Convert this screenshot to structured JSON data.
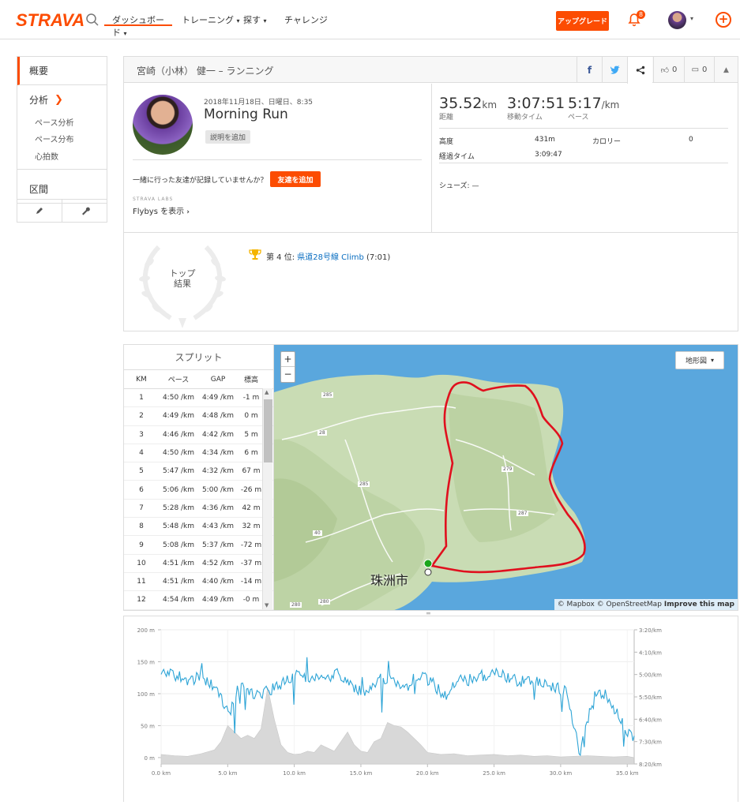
{
  "nav": {
    "logo": "STRAVA",
    "items": [
      "ダッシュボード",
      "トレーニング",
      "探す",
      "チャレンジ"
    ],
    "upgrade": "アップグレード",
    "notifications": "8"
  },
  "sidebar": {
    "overview": "概要",
    "analysis": "分析",
    "sub": [
      "ペース分析",
      "ペース分布",
      "心拍数"
    ],
    "segments": "区間"
  },
  "activity": {
    "header": "宮崎（小林） 健一 – ランニング",
    "kudos": "0",
    "comments": "0",
    "date": "2018年11月18日、日曜日、8:35",
    "title": "Morning Run",
    "add_desc": "説明を追加",
    "friends_question": "一緒に行った友達が記録していませんか？",
    "add_friends": "友達を追加",
    "labs": "STRAVA LABS",
    "flybys": "Flybys を表示",
    "stats": {
      "distance": "35.52",
      "distance_unit": "km",
      "distance_label": "距離",
      "moving_time": "3:07:51",
      "moving_label": "移動タイム",
      "pace": "5:17",
      "pace_unit": "/km",
      "pace_label": "ペース"
    },
    "elevation_label": "高度",
    "elevation_value": "431m",
    "calories_label": "カロリー",
    "calories_value": "0",
    "elapsed_label": "経過タイム",
    "elapsed_value": "3:09:47",
    "shoes": "シューズ: —",
    "top_results": "トップ\n結果",
    "achievement_prefix": "第 4 位: ",
    "achievement_link": "県道28号線 Climb",
    "achievement_time": " (7:01)"
  },
  "splits": {
    "title": "スプリット",
    "headers": [
      "KM",
      "ペース",
      "GAP",
      "標高"
    ],
    "rows": [
      [
        "1",
        "4:50 /km",
        "4:49 /km",
        "-1 m"
      ],
      [
        "2",
        "4:49 /km",
        "4:48 /km",
        "0 m"
      ],
      [
        "3",
        "4:46 /km",
        "4:42 /km",
        "5 m"
      ],
      [
        "4",
        "4:50 /km",
        "4:34 /km",
        "6 m"
      ],
      [
        "5",
        "5:47 /km",
        "4:32 /km",
        "67 m"
      ],
      [
        "6",
        "5:06 /km",
        "5:00 /km",
        "-26 m"
      ],
      [
        "7",
        "5:28 /km",
        "4:36 /km",
        "42 m"
      ],
      [
        "8",
        "5:48 /km",
        "4:43 /km",
        "32 m"
      ],
      [
        "9",
        "5:08 /km",
        "5:37 /km",
        "-72 m"
      ],
      [
        "10",
        "4:51 /km",
        "4:52 /km",
        "-37 m"
      ],
      [
        "11",
        "4:51 /km",
        "4:40 /km",
        "-14 m"
      ],
      [
        "12",
        "4:54 /km",
        "4:49 /km",
        "-0 m"
      ]
    ]
  },
  "map": {
    "terrain": "地形図",
    "city": "珠洲市",
    "attribution": "© Mapbox © OpenStreetMap",
    "improve": "Improve this map",
    "road_labels": [
      "285",
      "28",
      "285",
      "40",
      "280",
      "280",
      "279",
      "287",
      "28",
      "28",
      "28",
      "28"
    ]
  },
  "chart_data": {
    "type": "line",
    "x_ticks": [
      "0.0 km",
      "5.0 km",
      "10.0 km",
      "15.0 km",
      "20.0 km",
      "25.0 km",
      "30.0 km",
      "35.0 km"
    ],
    "y_left_ticks": [
      "200 m",
      "150 m",
      "100 m",
      "50 m",
      "0 m"
    ],
    "y_right_ticks": [
      "3:20/km",
      "4:10/km",
      "5:00/km",
      "5:50/km",
      "6:40/km",
      "7:30/km",
      "8:20/km"
    ],
    "x_range": [
      0,
      35.52
    ],
    "elevation_m": {
      "x": [
        0,
        1,
        2,
        3,
        4,
        4.5,
        5,
        5.5,
        6,
        6.5,
        7,
        7.5,
        8,
        8.5,
        9,
        9.5,
        10,
        10.5,
        11,
        11.5,
        12,
        12.5,
        13,
        13.5,
        14,
        14.5,
        15,
        15.5,
        16,
        16.5,
        17,
        17.5,
        18,
        18.5,
        19,
        19.5,
        20,
        21,
        22,
        23,
        24,
        25,
        26,
        27,
        28,
        29,
        30,
        31,
        32,
        33,
        34,
        35,
        35.5
      ],
      "y": [
        5,
        3,
        2,
        6,
        12,
        25,
        50,
        40,
        30,
        35,
        30,
        45,
        110,
        60,
        20,
        8,
        5,
        6,
        10,
        8,
        20,
        15,
        10,
        25,
        40,
        20,
        10,
        8,
        25,
        30,
        55,
        50,
        48,
        40,
        30,
        20,
        8,
        5,
        6,
        3,
        4,
        5,
        3,
        4,
        2,
        3,
        1,
        2,
        3,
        2,
        1,
        2,
        0
      ]
    },
    "pace_min_per_km_sample": [
      5.0,
      5.0,
      5.2,
      5.1,
      5.5,
      6.5,
      5.3,
      5.8,
      5.6,
      5.3,
      5.0,
      5.1,
      5.2,
      5.0,
      5.3,
      5.8,
      5.2,
      5.2,
      5.6,
      5.0,
      5.3,
      5.8,
      5.2,
      5.2,
      5.0,
      5.0,
      5.2,
      5.3,
      5.3,
      5.5,
      5.6,
      8.0,
      5.7,
      5.8,
      6.7,
      7.5
    ],
    "grid": true,
    "legend": "none"
  },
  "colors": {
    "accent": "#fc4c02",
    "route": "#e0101e",
    "pace_line": "#2da4d6",
    "elevation_fill": "#d8d8d8",
    "water": "#5aa7dd",
    "land": "#c9dcb4"
  }
}
